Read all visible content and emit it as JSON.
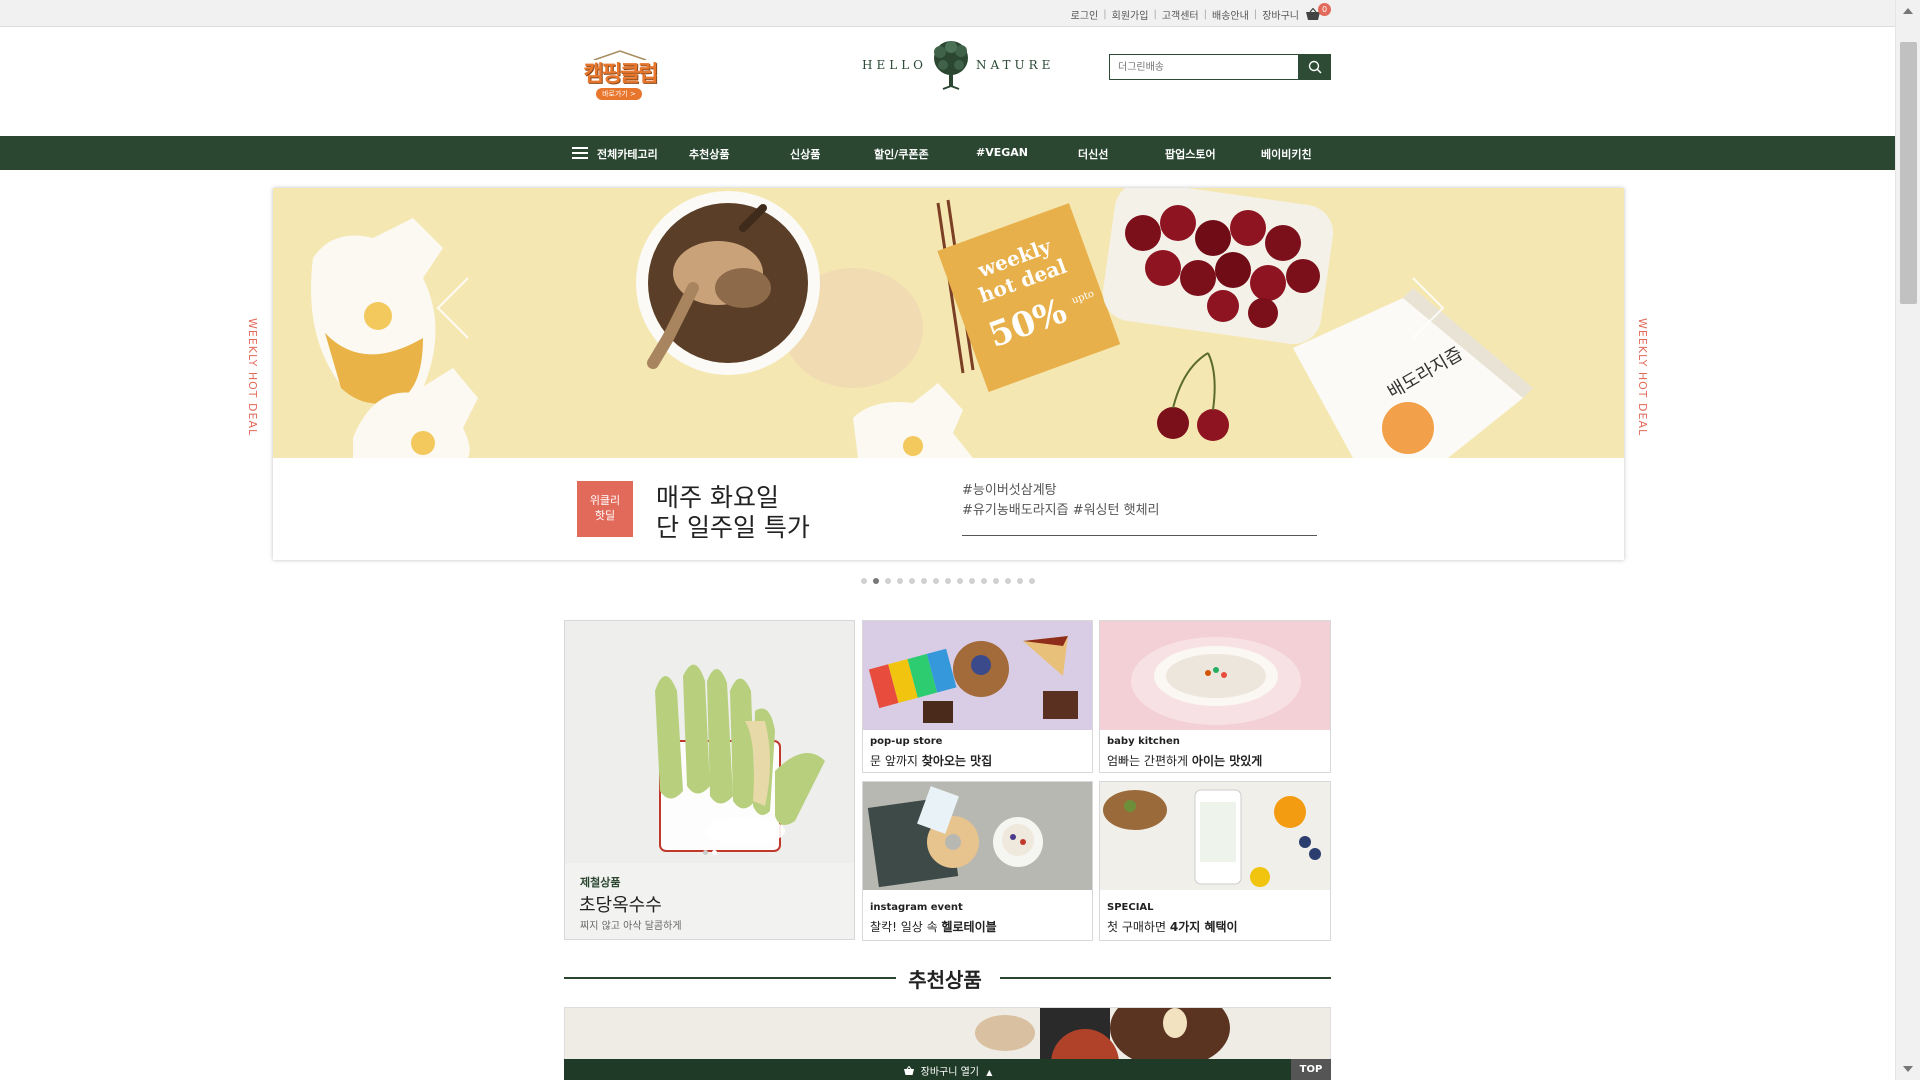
{
  "util": {
    "links": [
      "로그인",
      "회원가입",
      "고객센터",
      "배송안내",
      "장바구니"
    ],
    "cart_count": "0"
  },
  "header": {
    "camping_logo": "캠핑클럽",
    "camping_button": "바로가기 >",
    "brand_left": "HELLO",
    "brand_right": "NATURE",
    "search_placeholder": "더그린배송"
  },
  "nav": {
    "items": [
      "전체카테고리",
      "추천상품",
      "신상품",
      "할인/쿠폰존",
      "#VEGAN",
      "더신선",
      "팝업스토어",
      "베이비키친"
    ]
  },
  "banner": {
    "side_label": "WEEKLY HOT DEAL",
    "badge_line1": "위클리",
    "badge_line2": "핫딜",
    "title_line1": "매주 화요일",
    "title_line2": "단 일주일 특가",
    "tags_line1": "#능이버섯삼계탕",
    "tags_line2": "#유기농배도라지즙 #워싱턴 햇체리",
    "pouch_text": "배도라지즙",
    "box_text": "배도라지즙",
    "sticker_line1": "weekly",
    "sticker_line2": "hot deal",
    "sticker_line3": "50%",
    "sticker_upto": "upto",
    "dot_count": 15,
    "active_dot": 1
  },
  "grid": {
    "main": {
      "tag": "제철상품",
      "title": "초당옥수수",
      "subtitle": "찌지 않고 아삭 달콤하게"
    },
    "cards": [
      {
        "tag": "pop-up store",
        "text_plain": "문 앞까지 ",
        "text_bold": "찾아오는 맛집",
        "tag_color": "#2f3a8c"
      },
      {
        "tag": "baby kitchen",
        "text_plain": "엄빠는 간편하게 ",
        "text_bold": "아이는 맛있게",
        "tag_color": "#e26a5a"
      },
      {
        "tag": "instagram event",
        "text_plain": "찰칵! 일상 속 ",
        "text_bold": "헬로테이블",
        "tag_color": "#2b4731"
      },
      {
        "tag": "SPECIAL",
        "text_plain": "첫 구매하면 ",
        "text_bold": "4가지 혜택이",
        "tag_color": "#2b4731"
      }
    ]
  },
  "section": {
    "title": "추천상품"
  },
  "bottom_bar": {
    "cart_label": "장바구니 열기",
    "top_label": "TOP"
  },
  "colors": {
    "brand_green": "#2b4731",
    "accent_coral": "#e26a5a",
    "banner_bg": "#f5e7b2"
  }
}
